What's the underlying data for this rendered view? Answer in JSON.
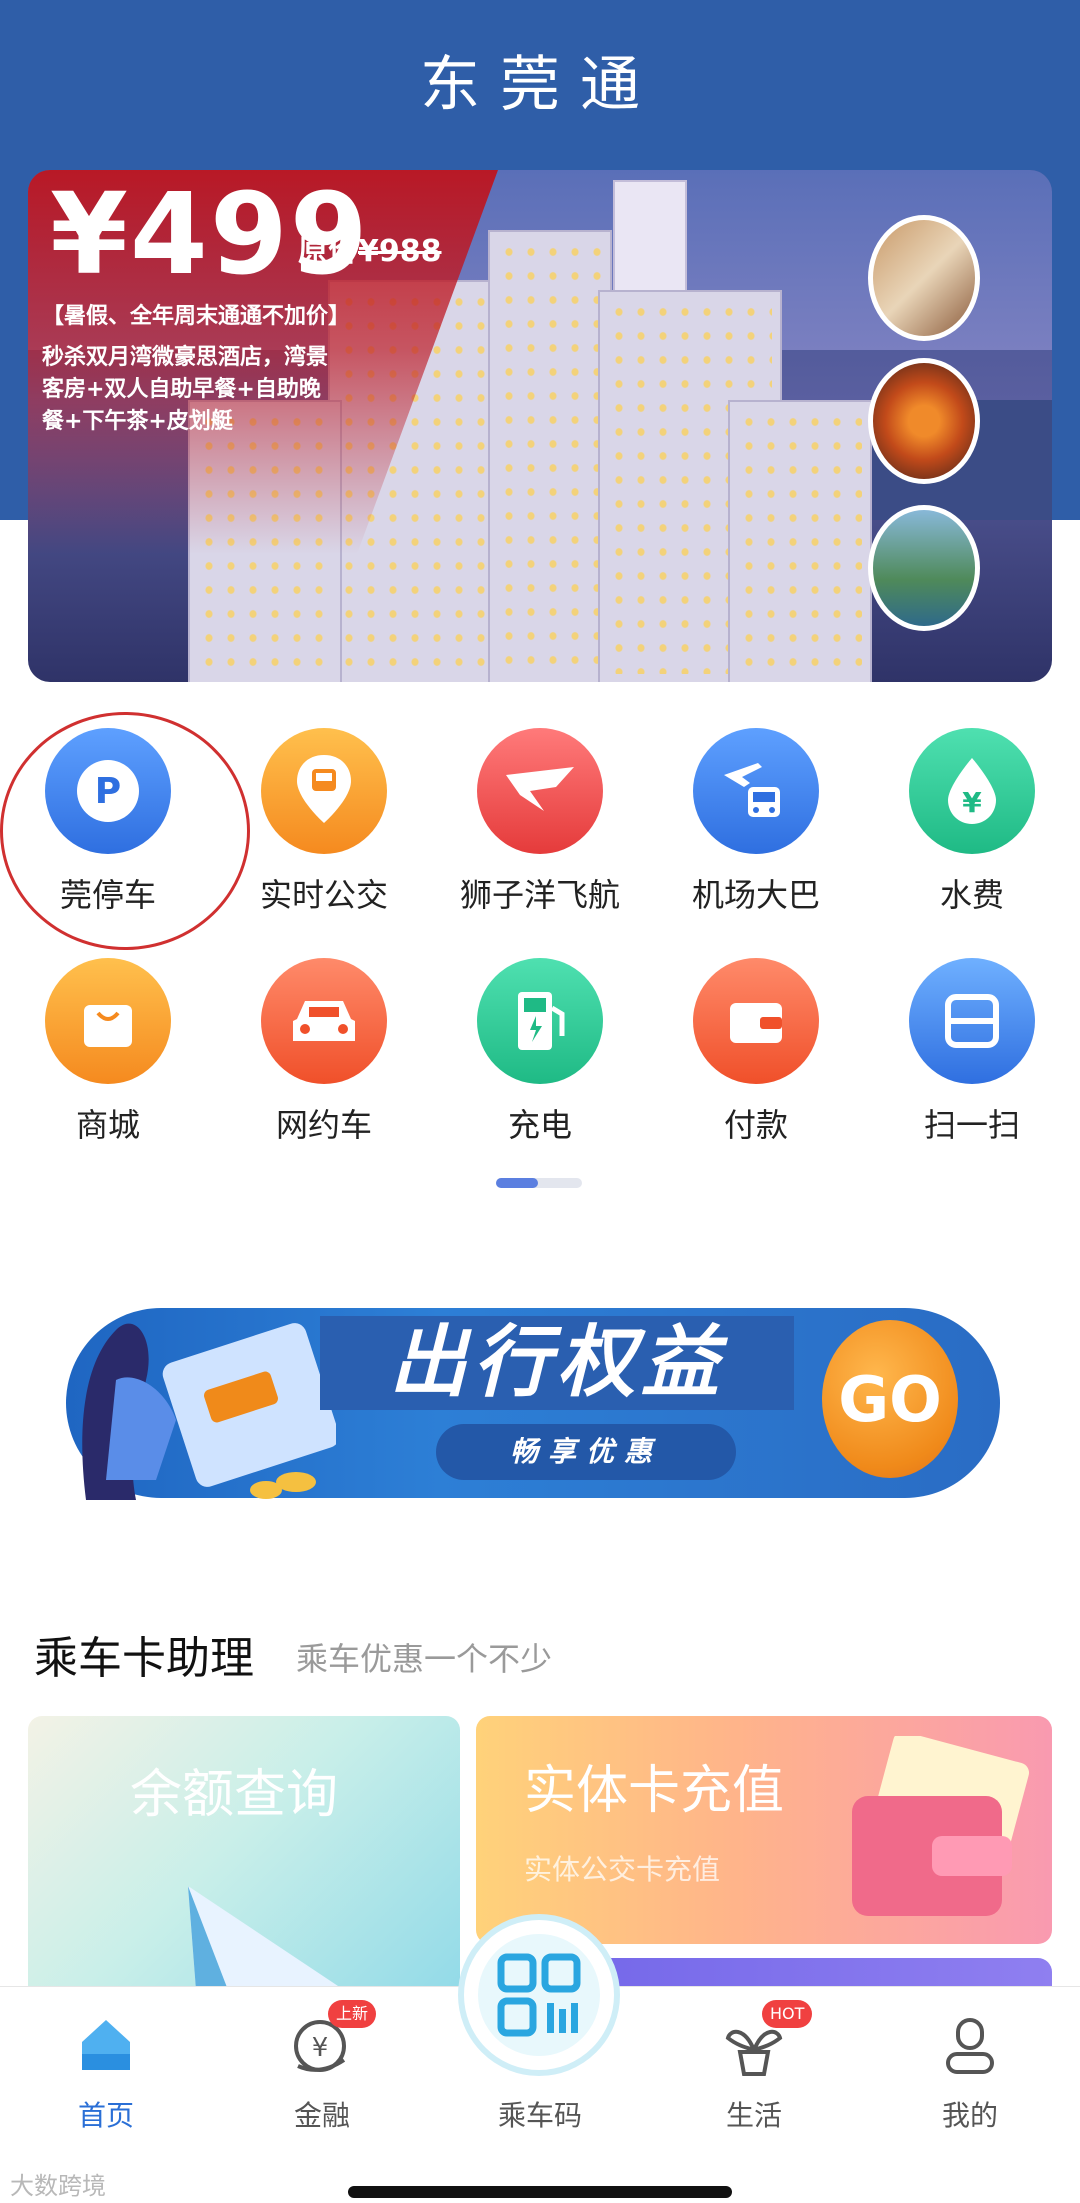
{
  "header": {
    "title": "东莞通"
  },
  "hero_banner": {
    "price": "¥499",
    "original_price_label": "原价",
    "original_price": "¥988",
    "tagline": "【暑假、全年周末通通不加价】",
    "description": "秒杀双月湾微豪思酒店，湾景客房+双人自助早餐+自助晚餐+下午茶+皮划艇"
  },
  "grid": {
    "items": [
      {
        "label": "莞停车",
        "icon": "parking-icon",
        "color_top": "#5ea0ff",
        "color_bottom": "#2f6fe0"
      },
      {
        "label": "实时公交",
        "icon": "bus-location-icon",
        "color_top": "#ffc04d",
        "color_bottom": "#f58a1f"
      },
      {
        "label": "狮子洋飞航",
        "icon": "ferry-logo-icon",
        "color_top": "#ff7a7a",
        "color_bottom": "#e53b3b"
      },
      {
        "label": "机场大巴",
        "icon": "airport-bus-icon",
        "color_top": "#5ea0ff",
        "color_bottom": "#2f6fe0"
      },
      {
        "label": "水费",
        "icon": "water-drop-yen-icon",
        "color_top": "#4fe0b0",
        "color_bottom": "#1fba85"
      },
      {
        "label": "商城",
        "icon": "shopping-bag-icon",
        "color_top": "#ffc04d",
        "color_bottom": "#f58a1f"
      },
      {
        "label": "网约车",
        "icon": "car-icon",
        "color_top": "#ff8a6a",
        "color_bottom": "#f0502a"
      },
      {
        "label": "充电",
        "icon": "charging-station-icon",
        "color_top": "#4fe0b0",
        "color_bottom": "#1fba85"
      },
      {
        "label": "付款",
        "icon": "wallet-icon",
        "color_top": "#ff8a6a",
        "color_bottom": "#f0502a"
      },
      {
        "label": "扫一扫",
        "icon": "scan-icon",
        "color_top": "#6fb0ff",
        "color_bottom": "#2f6fe0"
      }
    ]
  },
  "travel_banner": {
    "title": "出行权益",
    "subtitle": "畅享优惠",
    "button": "GO"
  },
  "section": {
    "title": "乘车卡助理",
    "subtitle": "乘车优惠一个不少",
    "cards": [
      {
        "title": "余额查询",
        "subtitle": ""
      },
      {
        "title": "实体卡充值",
        "subtitle": "实体公交卡充值"
      }
    ]
  },
  "bottom_nav": {
    "items": [
      {
        "label": "首页",
        "icon": "home-icon",
        "active": true
      },
      {
        "label": "金融",
        "icon": "finance-icon",
        "badge": "上新"
      },
      {
        "label": "乘车码",
        "icon": "qr-code-icon"
      },
      {
        "label": "生活",
        "icon": "plant-icon",
        "badge": "HOT"
      },
      {
        "label": "我的",
        "icon": "user-icon"
      }
    ]
  },
  "watermark": "大数跨境",
  "colors": {
    "brand_blue": "#2f5ea8",
    "accent_blue": "#2a6fd6",
    "badge_red": "#f04040"
  }
}
